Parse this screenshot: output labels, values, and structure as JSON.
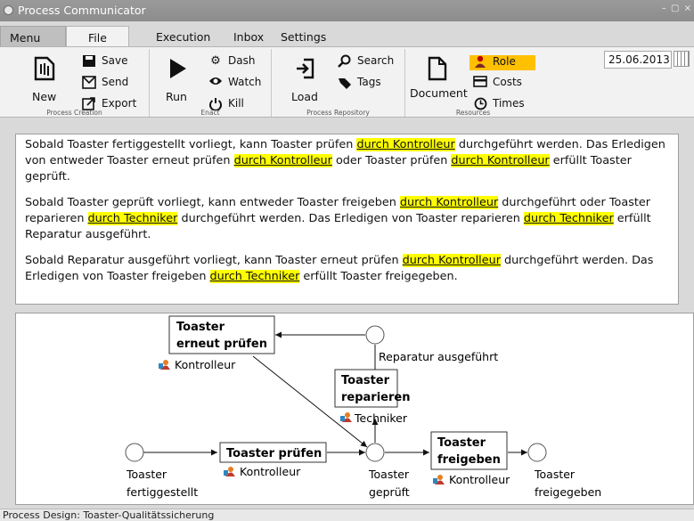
{
  "window": {
    "title": "Process Communicator",
    "controls": "– ▢ ×"
  },
  "tabs": {
    "menu": "Menu",
    "file": "File",
    "execution": "Execution",
    "inbox": "Inbox",
    "settings": "Settings"
  },
  "ribbon": {
    "process_creation": {
      "label": "Process Creation",
      "new": "New",
      "save": "Save",
      "send": "Send",
      "export": "Export"
    },
    "enact": {
      "label": "Enact",
      "run": "Run",
      "dash": "Dash",
      "watch": "Watch",
      "kill": "Kill"
    },
    "process_repository": {
      "label": "Process Repository",
      "load": "Load",
      "search": "Search",
      "tags": "Tags"
    },
    "resources": {
      "label": "Resources",
      "document": "Document",
      "role": "Role",
      "costs": "Costs",
      "times": "Times"
    },
    "date": "25.06.2013"
  },
  "text": {
    "p1": {
      "a": "Sobald Toaster fertiggestellt vorliegt, kann Toaster prüfen ",
      "h1": "durch Kontrolleur",
      "b": " durchgeführt werden. Das Erledigen von entweder Toaster  erneut prüfen ",
      "h2": "durch Kontrolleur",
      "c": " oder Toaster prüfen ",
      "h3": "durch Kontrolleur",
      "d": " erfüllt Toaster geprüft."
    },
    "p2": {
      "a": "Sobald Toaster geprüft vorliegt, kann entweder Toaster freigeben ",
      "h1": "durch Kontrolleur",
      "b": " durchgeführt oder Toaster reparieren ",
      "h2": "durch Techniker",
      "c": " durchgeführt werden. Das Erledigen von Toaster reparieren ",
      "h3": "durch Techniker",
      "d": " erfüllt Reparatur ausgeführt."
    },
    "p3": {
      "a": "Sobald Reparatur ausgeführt vorliegt, kann Toaster  erneut prüfen ",
      "h1": "durch Kontrolleur",
      "b": " durchgeführt werden. Das Erledigen von Toaster freigeben ",
      "h2": "durch Techniker",
      "c": " erfüllt Toaster freigegeben."
    }
  },
  "diagram": {
    "tasks": {
      "erneut_l1": "Toaster",
      "erneut_l2": "erneut prüfen",
      "reparieren_l1": "Toaster",
      "reparieren_l2": "reparieren",
      "pruefen": "Toaster prüfen",
      "freigeben_l1": "Toaster",
      "freigeben_l2": "freigeben"
    },
    "roles": {
      "kontrolleur": "Kontrolleur",
      "techniker": "Techniker"
    },
    "events": {
      "reparatur": "Reparatur ausgeführt",
      "fertig_l1": "Toaster",
      "fertig_l2": "fertiggestellt",
      "geprueft_l1": "Toaster",
      "geprueft_l2": "geprüft",
      "freigegeben_l1": "Toaster",
      "freigegeben_l2": "freigegeben"
    }
  },
  "status": "Process Design: Toaster-Qualitätssicherung"
}
